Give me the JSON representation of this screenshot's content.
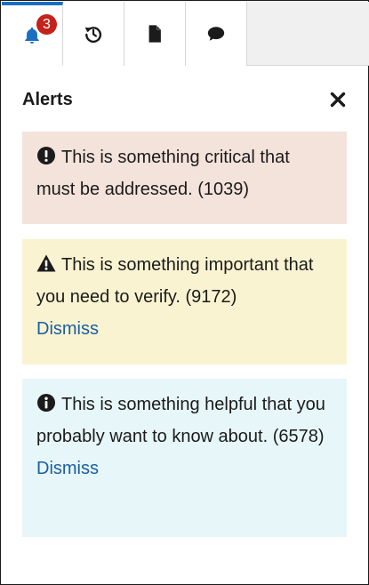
{
  "tabs": [
    {
      "name": "alerts",
      "badge": "3",
      "active": true
    },
    {
      "name": "history"
    },
    {
      "name": "documents"
    },
    {
      "name": "comments"
    }
  ],
  "panel": {
    "title": "Alerts"
  },
  "alerts": [
    {
      "type": "error",
      "icon": "exclamation-circle-icon",
      "text": "This is something critical that must be addressed. (1039)"
    },
    {
      "type": "warning",
      "icon": "warning-triangle-icon",
      "text": "This is something important that you need to verify. (9172)",
      "dismiss": "Dismiss"
    },
    {
      "type": "info",
      "icon": "info-circle-icon",
      "text": "This is something helpful that you probably want to know about. (6578)",
      "dismiss": "Dismiss"
    }
  ],
  "colors": {
    "accent": "#1a6fc2",
    "badge": "#c4221b",
    "link": "#1a5fa3",
    "error_bg": "#f4e3db",
    "warning_bg": "#faf3d1",
    "info_bg": "#e7f6f8"
  }
}
